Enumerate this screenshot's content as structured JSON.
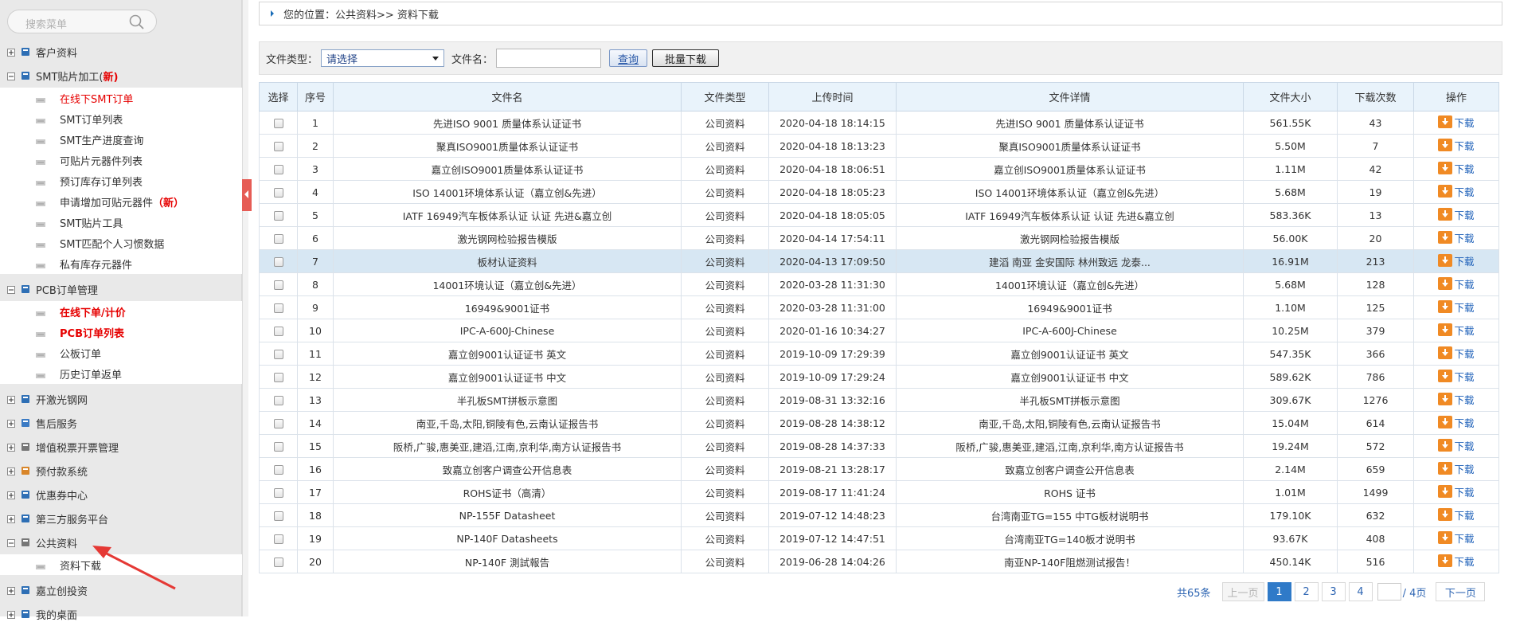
{
  "sidebar": {
    "search_placeholder": "搜索菜单",
    "groups": [
      {
        "label": "客户资料",
        "expanded": false
      },
      {
        "label": "SMT贴片加工(",
        "badge": "新)",
        "expanded": true,
        "items": [
          {
            "label": "在线下SMT订单",
            "red": true
          },
          {
            "label": "SMT订单列表"
          },
          {
            "label": "SMT生产进度查询"
          },
          {
            "label": "可贴片元器件列表"
          },
          {
            "label": "预订库存订单列表"
          },
          {
            "label": "申请增加可贴元器件",
            "badge": "（新）"
          },
          {
            "label": "SMT贴片工具"
          },
          {
            "label": "SMT匹配个人习惯数据"
          },
          {
            "label": "私有库存元器件"
          }
        ]
      },
      {
        "label": "PCB订单管理",
        "expanded": true,
        "items": [
          {
            "label": "在线下单/计价",
            "red": true,
            "bold": true
          },
          {
            "label": "PCB订单列表",
            "red": true,
            "bold": true
          },
          {
            "label": "公板订单"
          },
          {
            "label": "历史订单返单"
          }
        ]
      },
      {
        "label": "开激光钢网",
        "expanded": false
      },
      {
        "label": "售后服务",
        "expanded": false
      },
      {
        "label": "增值税票开票管理",
        "expanded": false
      },
      {
        "label": "预付款系统",
        "expanded": false
      },
      {
        "label": "优惠券中心",
        "expanded": false
      },
      {
        "label": "第三方服务平台",
        "expanded": false
      },
      {
        "label": "公共资料",
        "expanded": true,
        "items": [
          {
            "label": "资料下载"
          }
        ]
      },
      {
        "label": "嘉立创投资",
        "expanded": false
      },
      {
        "label": "我的桌面",
        "expanded": false
      }
    ]
  },
  "breadcrumb": "您的位置：公共资料>> 资料下载",
  "filter": {
    "type_label": "文件类型：",
    "type_value": "请选择",
    "name_label": "文件名：",
    "name_value": "",
    "query_label": "查询",
    "bulk_label": "批量下载"
  },
  "table": {
    "headers": [
      "选择",
      "序号",
      "文件名",
      "文件类型",
      "上传时间",
      "文件详情",
      "文件大小",
      "下载次数",
      "操作"
    ],
    "action_label": "下载",
    "highlighted_row": 7,
    "rows": [
      [
        "1",
        "先进ISO 9001 质量体系认证证书",
        "公司资料",
        "2020-04-18 18:14:15",
        "先进ISO 9001 质量体系认证证书",
        "561.55K",
        "43"
      ],
      [
        "2",
        "聚真ISO9001质量体系认证证书",
        "公司资料",
        "2020-04-18 18:13:23",
        "聚真ISO9001质量体系认证证书",
        "5.50M",
        "7"
      ],
      [
        "3",
        "嘉立创ISO9001质量体系认证证书",
        "公司资料",
        "2020-04-18 18:06:51",
        "嘉立创ISO9001质量体系认证证书",
        "1.11M",
        "42"
      ],
      [
        "4",
        "ISO 14001环境体系认证（嘉立创&先进）",
        "公司资料",
        "2020-04-18 18:05:23",
        "ISO 14001环境体系认证（嘉立创&先进）",
        "5.68M",
        "19"
      ],
      [
        "5",
        "IATF 16949汽车板体系认证 认证 先进&嘉立创",
        "公司资料",
        "2020-04-18 18:05:05",
        "IATF 16949汽车板体系认证 认证 先进&嘉立创",
        "583.36K",
        "13"
      ],
      [
        "6",
        "激光钢网检验报告模版",
        "公司资料",
        "2020-04-14 17:54:11",
        "激光钢网检验报告模版",
        "56.00K",
        "20"
      ],
      [
        "7",
        "板材认证资料",
        "公司资料",
        "2020-04-13 17:09:50",
        "建滔 南亚 金安国际 林州致远 龙泰...",
        "16.91M",
        "213"
      ],
      [
        "8",
        "14001环境认证（嘉立创&先进）",
        "公司资料",
        "2020-03-28 11:31:30",
        "14001环境认证（嘉立创&先进）",
        "5.68M",
        "128"
      ],
      [
        "9",
        "16949&9001证书",
        "公司资料",
        "2020-03-28 11:31:00",
        "16949&9001证书",
        "1.10M",
        "125"
      ],
      [
        "10",
        "IPC-A-600J-Chinese",
        "公司资料",
        "2020-01-16 10:34:27",
        "IPC-A-600J-Chinese",
        "10.25M",
        "379"
      ],
      [
        "11",
        "嘉立创9001认证证书 英文",
        "公司资料",
        "2019-10-09 17:29:39",
        "嘉立创9001认证证书 英文",
        "547.35K",
        "366"
      ],
      [
        "12",
        "嘉立创9001认证证书 中文",
        "公司资料",
        "2019-10-09 17:29:24",
        "嘉立创9001认证证书 中文",
        "589.62K",
        "786"
      ],
      [
        "13",
        "半孔板SMT拼板示意图",
        "公司资料",
        "2019-08-31 13:32:16",
        "半孔板SMT拼板示意图",
        "309.67K",
        "1276"
      ],
      [
        "14",
        "南亚,千岛,太阳,铜陵有色,云南认证报告书",
        "公司资料",
        "2019-08-28 14:38:12",
        "南亚,千岛,太阳,铜陵有色,云南认证报告书",
        "15.04M",
        "614"
      ],
      [
        "15",
        "阪桥,广骏,惠美亚,建滔,江南,京利华,南方认证报告书",
        "公司资料",
        "2019-08-28 14:37:33",
        "阪桥,广骏,惠美亚,建滔,江南,京利华,南方认证报告书",
        "19.24M",
        "572"
      ],
      [
        "16",
        "致嘉立创客户调查公开信息表",
        "公司资料",
        "2019-08-21 13:28:17",
        "致嘉立创客户调查公开信息表",
        "2.14M",
        "659"
      ],
      [
        "17",
        "ROHS证书（高清）",
        "公司资料",
        "2019-08-17 11:41:24",
        "ROHS 证书",
        "1.01M",
        "1499"
      ],
      [
        "18",
        "NP-155F Datasheet",
        "公司资料",
        "2019-07-12 14:48:23",
        "台湾南亚TG=155 中TG板材说明书",
        "179.10K",
        "632"
      ],
      [
        "19",
        "NP-140F Datasheets",
        "公司资料",
        "2019-07-12 14:47:51",
        "台湾南亚TG=140板才说明书",
        "93.67K",
        "408"
      ],
      [
        "20",
        "NP-140F 測試報告",
        "公司资料",
        "2019-06-28 14:04:26",
        "南亚NP-140F阻燃测试报告！",
        "450.14K",
        "516"
      ]
    ]
  },
  "pagination": {
    "total": "共65条",
    "prev": "上一页",
    "pages": [
      "1",
      "2",
      "3",
      "4"
    ],
    "current": "1",
    "jump_value": "",
    "of_pages": "/ 4页",
    "next": "下一页"
  }
}
